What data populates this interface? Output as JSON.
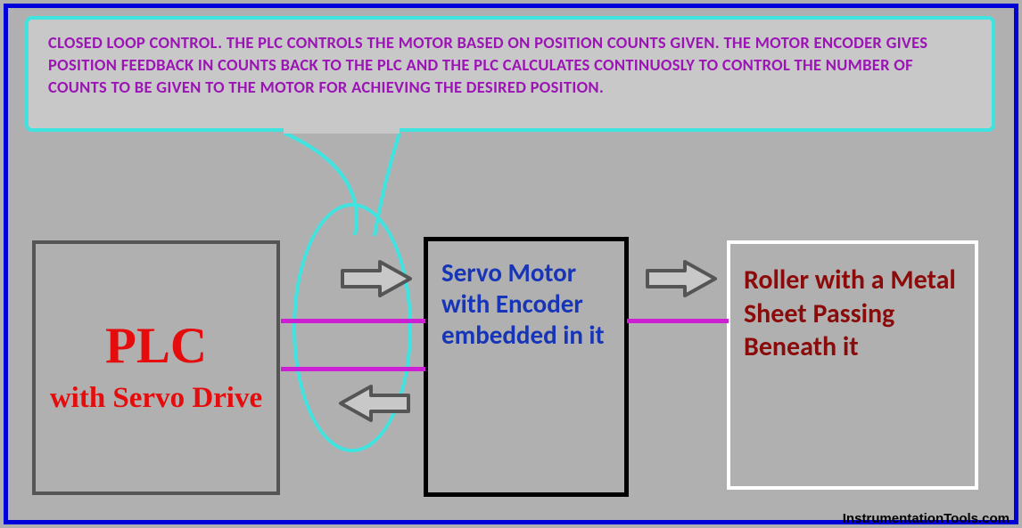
{
  "callout": {
    "text": "CLOSED LOOP CONTROL. THE PLC CONTROLS THE MOTOR BASED ON POSITION COUNTS GIVEN. THE MOTOR ENCODER GIVES POSITION FEEDBACK IN COUNTS BACK TO THE PLC AND THE PLC CALCULATES CONTINUOSLY TO CONTROL THE NUMBER OF COUNTS TO BE GIVEN TO THE MOTOR FOR ACHIEVING THE DESIRED POSITION."
  },
  "boxes": {
    "plc": {
      "title": "PLC",
      "subtitle": "with Servo Drive"
    },
    "servo": {
      "text": "Servo Motor with Encoder embedded in it"
    },
    "roller": {
      "text": "Roller with a Metal Sheet Passing Beneath it"
    }
  },
  "watermark": "InstrumentationTools.com",
  "colors": {
    "outer_border": "#0000d8",
    "callout_border": "#3fe4e0",
    "callout_text": "#9b15b5",
    "plc_text": "#e40c0c",
    "servo_text": "#1735b7",
    "roller_text": "#8b0b0b",
    "connector_line": "#cc1fd4",
    "arrow_stroke": "#555555",
    "background": "#b0b0b0"
  }
}
